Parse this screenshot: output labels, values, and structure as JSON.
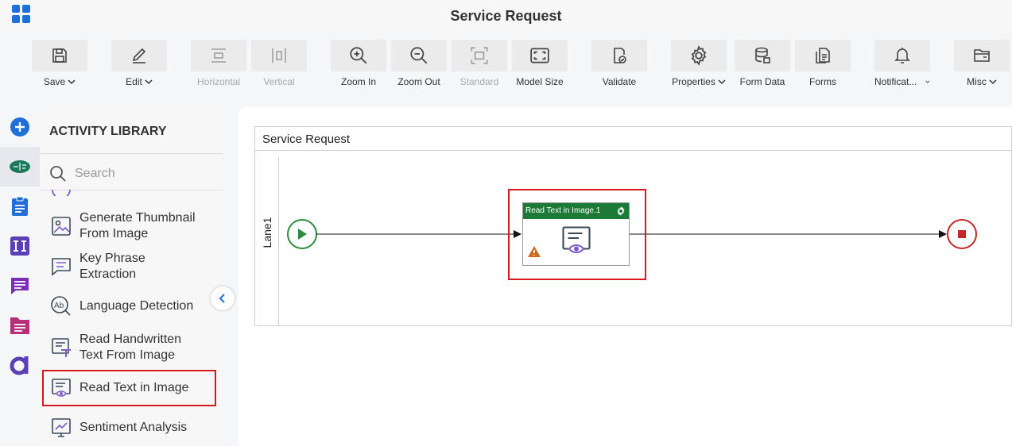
{
  "app": {
    "title": "Service Request"
  },
  "toolbar": [
    {
      "id": "save",
      "label": "Save",
      "icon": "save-icon",
      "dropdown": true,
      "disabled": false
    },
    {
      "id": "edit",
      "label": "Edit",
      "icon": "edit-icon",
      "dropdown": true,
      "disabled": false
    },
    {
      "id": "horizontal",
      "label": "Horizontal",
      "icon": "horizontal-layout-icon",
      "dropdown": false,
      "disabled": true
    },
    {
      "id": "vertical",
      "label": "Vertical",
      "icon": "vertical-layout-icon",
      "dropdown": false,
      "disabled": true
    },
    {
      "id": "zoom-in",
      "label": "Zoom In",
      "icon": "zoom-in-icon",
      "dropdown": false,
      "disabled": false
    },
    {
      "id": "zoom-out",
      "label": "Zoom Out",
      "icon": "zoom-out-icon",
      "dropdown": false,
      "disabled": false
    },
    {
      "id": "standard",
      "label": "Standard",
      "icon": "standard-size-icon",
      "dropdown": false,
      "disabled": true
    },
    {
      "id": "model-size",
      "label": "Model Size",
      "icon": "model-size-icon",
      "dropdown": false,
      "disabled": false
    },
    {
      "id": "validate",
      "label": "Validate",
      "icon": "validate-icon",
      "dropdown": false,
      "disabled": false
    },
    {
      "id": "properties",
      "label": "Properties",
      "icon": "gear-icon",
      "dropdown": true,
      "disabled": false
    },
    {
      "id": "form-data",
      "label": "Form Data",
      "icon": "database-icon",
      "dropdown": false,
      "disabled": false
    },
    {
      "id": "forms",
      "label": "Forms",
      "icon": "forms-icon",
      "dropdown": false,
      "disabled": false
    },
    {
      "id": "notifications",
      "label": "Notificat...",
      "icon": "bell-icon",
      "dropdown": true,
      "disabled": false
    },
    {
      "id": "misc",
      "label": "Misc",
      "icon": "folder-icon",
      "dropdown": true,
      "disabled": false
    }
  ],
  "rail": [
    {
      "id": "add",
      "icon": "add-circle-icon",
      "color": "#1e6fd9",
      "active": false
    },
    {
      "id": "ai",
      "icon": "brain-icon",
      "color": "#1b7a5a",
      "active": true
    },
    {
      "id": "tasks",
      "icon": "clipboard-icon",
      "color": "#1e6fd9",
      "active": false
    },
    {
      "id": "integration",
      "icon": "integration-icon",
      "color": "#5b3fb5",
      "active": false
    },
    {
      "id": "messages",
      "icon": "message-icon",
      "color": "#7b2fb5",
      "active": false
    },
    {
      "id": "documents",
      "icon": "document-icon",
      "color": "#b52f7a",
      "active": false
    },
    {
      "id": "apps",
      "icon": "app-logo-icon",
      "color": "#5b3fb5",
      "active": false
    }
  ],
  "library": {
    "header": "ACTIVITY LIBRARY",
    "search_placeholder": "Search",
    "items": [
      {
        "label": "Generate Thumbnail From Image",
        "line1": "Generate Thumbnail",
        "line2": "From Image",
        "icon": "thumbnail-icon"
      },
      {
        "label": "Key Phrase Extraction",
        "line1": "Key Phrase",
        "line2": "Extraction",
        "icon": "key-phrase-icon"
      },
      {
        "label": "Language Detection",
        "line1": "Language Detection",
        "line2": "",
        "icon": "language-detection-icon"
      },
      {
        "label": "Read Handwritten Text From Image",
        "line1": "Read Handwritten",
        "line2": "Text From Image",
        "icon": "handwritten-text-icon"
      },
      {
        "label": "Read Text in Image",
        "line1": "Read Text in Image",
        "line2": "",
        "icon": "read-text-icon",
        "highlighted": true
      },
      {
        "label": "Sentiment Analysis",
        "line1": "Sentiment Analysis",
        "line2": "",
        "icon": "sentiment-icon"
      }
    ]
  },
  "canvas": {
    "pool_title": "Service Request",
    "lane_label": "Lane1",
    "task": {
      "title": "Read Text in Image.1",
      "has_warning": true,
      "highlighted": true
    }
  },
  "colors": {
    "task_header": "#1b7a36",
    "start_event": "#2e8b3e",
    "end_event": "#c62828",
    "highlight": "#d7191f",
    "accent_blue": "#1e6fd9"
  }
}
